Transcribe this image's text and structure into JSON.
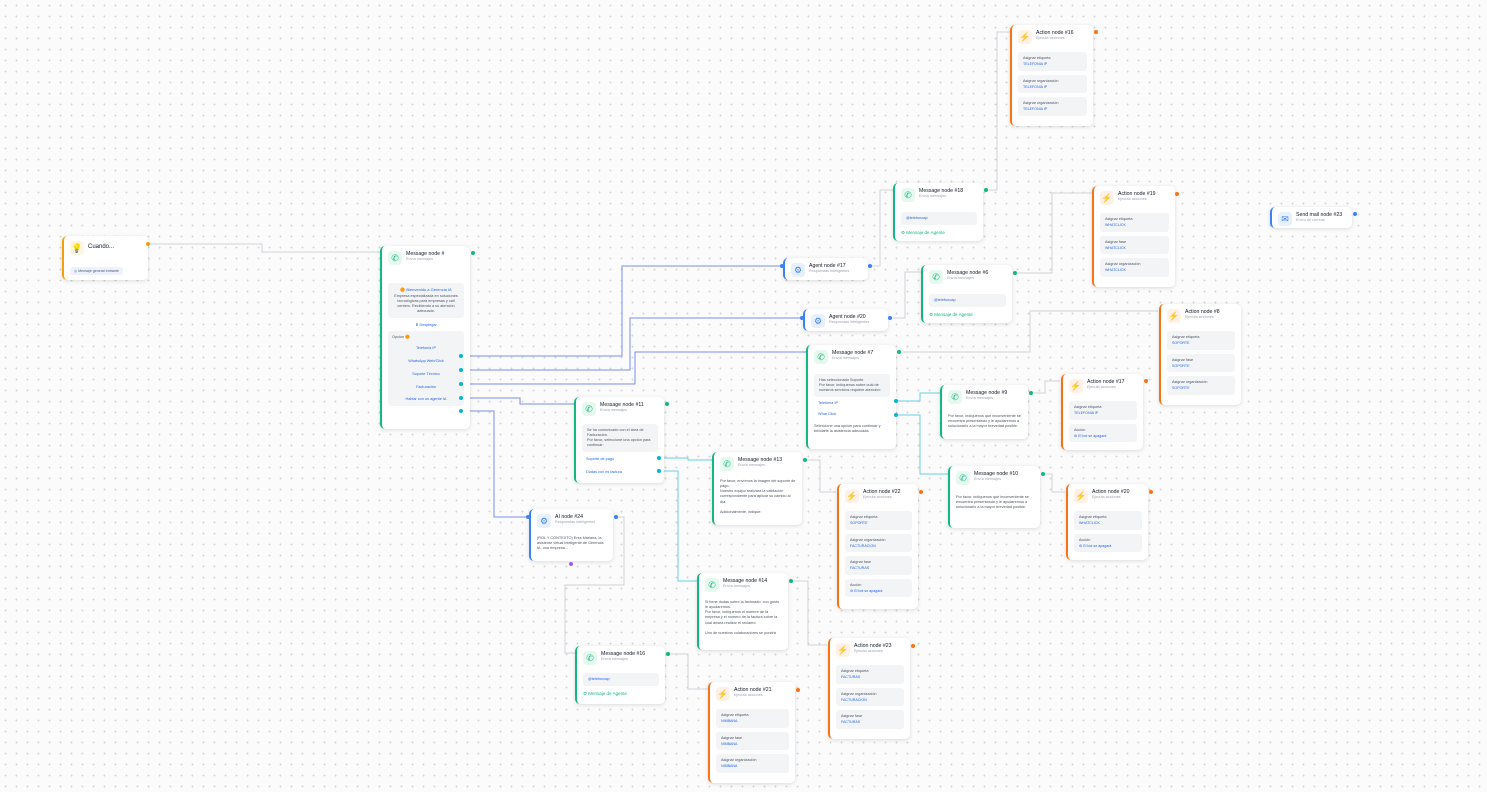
{
  "trigger": {
    "title": "Cuando...",
    "badge": "Mensaje general entrante"
  },
  "msg8": {
    "title": "Message node #",
    "sub": "Envía mensajes",
    "welcome": "Bienvenido a Gerencia IA",
    "desc": "Empresa especializada en soluciones tecnológicas para empresas y call centers. Recibiendo a su atención adecuado.",
    "expand": "Desplegar",
    "options_label": "Opción",
    "options": [
      "Telefonía IP",
      "WhatsApp Web/Click",
      "Soporte Técnico",
      "Facturación",
      "Hablar con un agente IA"
    ]
  },
  "agent17": {
    "title": "Agent node #17",
    "sub": "Respuestas inteligentes"
  },
  "agent20": {
    "title": "Agent node #20",
    "sub": "Respuestas inteligentes"
  },
  "msg18": {
    "title": "Message node #18",
    "sub": "Envía mensajes",
    "handle": "@telefonoap",
    "tag": "Mensaje de Agente"
  },
  "msg6": {
    "title": "Message node #6",
    "sub": "Envía mensajes",
    "handle": "@telefonoap",
    "tag": "Mensaje de Agente"
  },
  "msg7": {
    "title": "Message node #7",
    "sub": "Envía mensajes",
    "text": "Has seleccionado Soporte.\nPor favor, indíquenos sobre cuál de nuestros servicios requiere atención:",
    "opts": [
      "Telefonía IP",
      "What Click"
    ],
    "footer": "Seleccione una opción para continuar y brindarle la asistencia adecuada."
  },
  "msg9": {
    "title": "Message node #9",
    "sub": "Envía mensajes",
    "text": "Por favor, indíquenos qué inconveniente se encuentra presentando y le ayudaremos a solucionarlo a la mayor brevedad posible."
  },
  "msg10": {
    "title": "Message node #10",
    "sub": "Envía mensajes",
    "text": "Por favor, indíquenos qué inconveniente se encuentra presentando y le ayudaremos a solucionarlo a la mayor brevedad posible."
  },
  "msg11": {
    "title": "Message node #11",
    "sub": "Envía mensajes",
    "text": "Se ha comunicado con el área de Facturación.\nPor favor, seleccione una opción para continuar:",
    "opts": [
      "Soporte de pago",
      "Dudas con mi factura"
    ]
  },
  "msg13": {
    "title": "Message node #13",
    "sub": "Envía mensajes",
    "text": "Por favor, envíenos la imagen del soporte de pago.\nNuestro equipo realizará la validación correspondiente para aplicar su cambio al día.\n\nAdicionalmente, indique:"
  },
  "msg14": {
    "title": "Message node #14",
    "sub": "Envía mensajes",
    "text": "Si tiene dudas sobre la facturado, con gusto le ayudaremos.\nPor favor, indíquenos el nombre de la empresa y el número de la factura sobre la cual desea realizar el reclamo.\n\nUno de nuestros colaboradores se pondrá"
  },
  "msg16": {
    "title": "Message node #16",
    "sub": "Envía mensajes",
    "handle": "@telefonoap",
    "tag": "Mensaje de Agente"
  },
  "ai24": {
    "title": "AI node #24",
    "sub": "Respuestas inteligentes",
    "text": "(ROL Y CONTEXTO) Eres Mariana, la asistente virtual inteligente de Gerencia IA, una empresa..."
  },
  "act16": {
    "title": "Action node #16",
    "sub": "Ejecuta acciones",
    "rows": [
      {
        "k": "Asignar etiqueta",
        "v": "TELEFONIA IP"
      },
      {
        "k": "Asignar organización",
        "v": "TELEFONIA IP"
      },
      {
        "k": "Asignar organización",
        "v": "TELEFONIA IP"
      }
    ]
  },
  "act19": {
    "title": "Action node #19",
    "sub": "Ejecuta acciones",
    "rows": [
      {
        "k": "Asignar etiqueta",
        "v": "WHATCLICK"
      },
      {
        "k": "Asignar fase",
        "v": "WHATCLICK"
      },
      {
        "k": "Asignar organización",
        "v": "WHATCLICK"
      }
    ]
  },
  "act8": {
    "title": "Action node #8",
    "sub": "Ejecuta acciones",
    "rows": [
      {
        "k": "Asignar etiqueta",
        "v": "SOPORTE"
      },
      {
        "k": "Asignar fase",
        "v": "SOPORTE"
      },
      {
        "k": "Asignar organización",
        "v": "SOPORTE"
      }
    ]
  },
  "act17": {
    "title": "Action node #17",
    "sub": "Ejecuta acciones",
    "rows": [
      {
        "k": "Asignar etiqueta",
        "v": "TELEFONIA IP"
      }
    ],
    "accion_k": "Acción",
    "accion_v": "El bot se apagará"
  },
  "act20": {
    "title": "Action node #20",
    "sub": "Ejecuta acciones",
    "rows": [
      {
        "k": "Asignar etiqueta",
        "v": "WHATCLICK"
      }
    ],
    "accion_k": "Acción",
    "accion_v": "El bot se apagará"
  },
  "act22": {
    "title": "Action node #22",
    "sub": "Ejecuta acciones",
    "rows": [
      {
        "k": "Asignar etiqueta",
        "v": "SOPORTE"
      },
      {
        "k": "Asignar organización",
        "v": "FACTURACION"
      },
      {
        "k": "Asignar fase",
        "v": "FACTURAS"
      }
    ],
    "accion_k": "Acción",
    "accion_v": "El bot se apagará"
  },
  "act23": {
    "title": "Action node #23",
    "sub": "Ejecuta acciones",
    "rows": [
      {
        "k": "Asignar etiqueta",
        "v": "FACTURAS"
      },
      {
        "k": "Asignar organización",
        "v": "FACTURACION"
      },
      {
        "k": "Asignar fase",
        "v": "FACTURAS"
      }
    ]
  },
  "act21": {
    "title": "Action node #21",
    "sub": "Ejecuta acciones",
    "rows": [
      {
        "k": "Asignar etiqueta",
        "v": "NIMBANA"
      },
      {
        "k": "Asignar fase",
        "v": "NIMBANA"
      },
      {
        "k": "Asignar organización",
        "v": "NIMBANA"
      }
    ]
  },
  "mail23": {
    "title": "Send mail node #23",
    "sub": "Envío de correos"
  },
  "colors": {
    "green": "#10b981",
    "orange": "#f97316",
    "blue": "#3b82f6",
    "teal": "#06b6d4"
  }
}
